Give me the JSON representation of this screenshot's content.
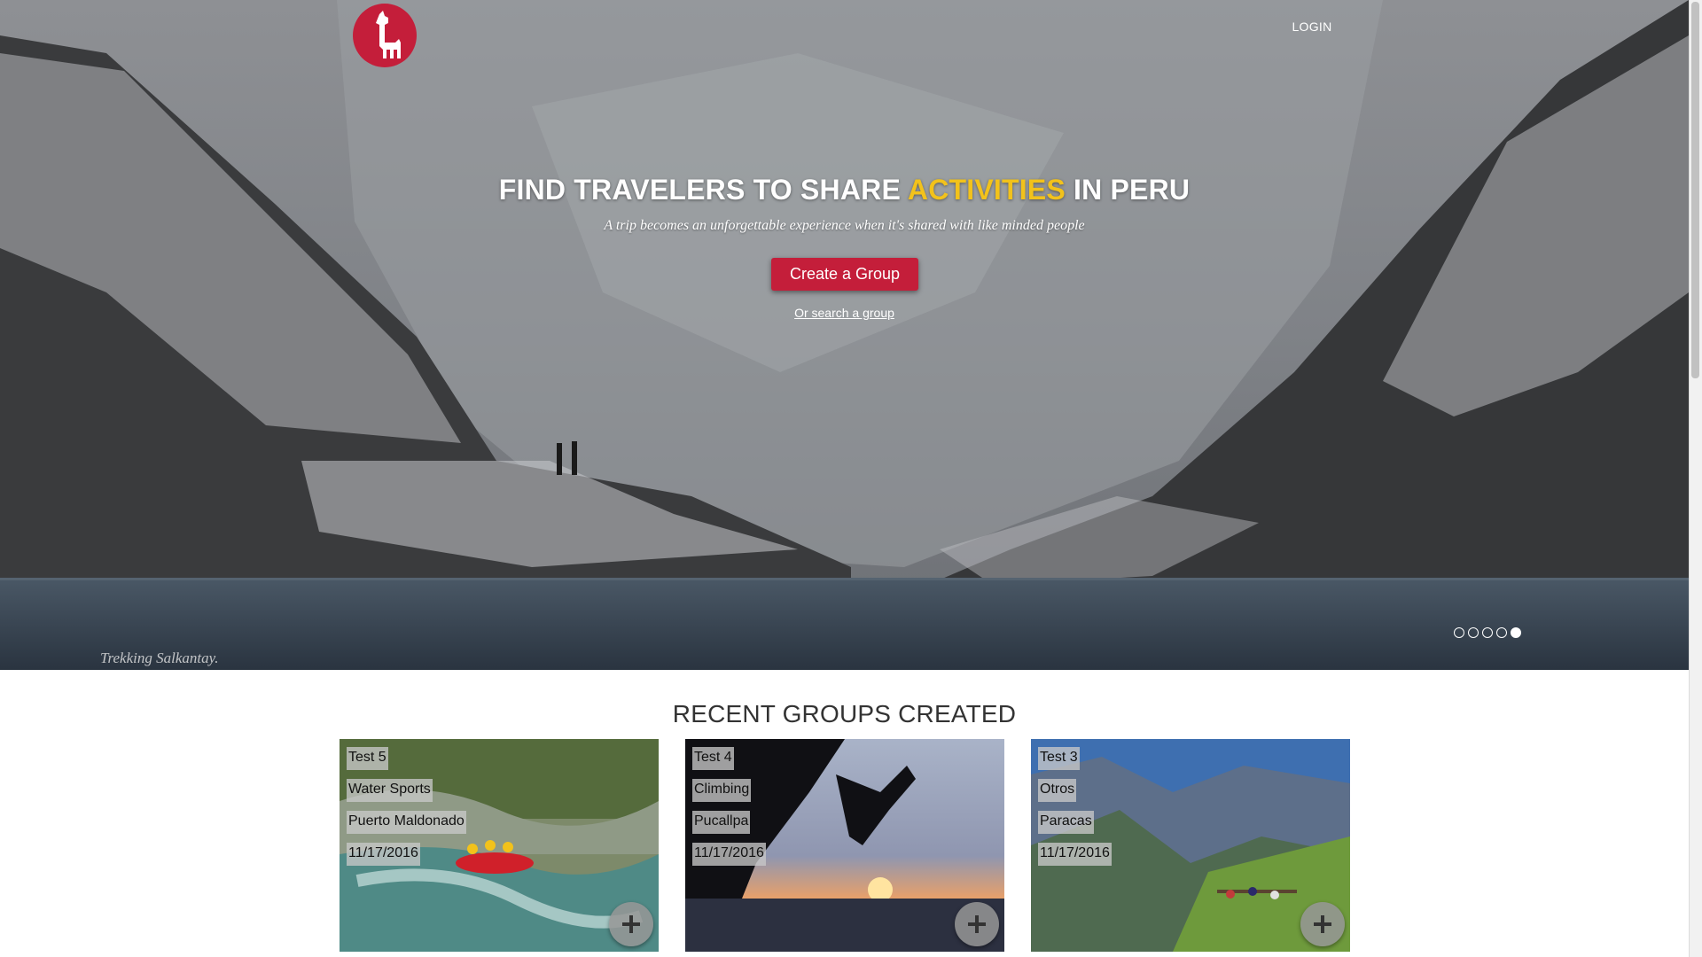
{
  "header": {
    "logo_icon": "llama-icon",
    "login_label": "LOGIN"
  },
  "hero": {
    "title_before": "FIND TRAVELERS TO SHARE ",
    "title_accent": "ACTIVITIES",
    "title_after": " IN PERU",
    "subtitle": "A trip becomes an unforgettable experience when it's shared with like minded people",
    "create_button_label": "Create a Group",
    "search_link_label": "Or search a group",
    "caption": "Trekking Salkantay.",
    "slide_count": 5,
    "active_slide": 5,
    "colors": {
      "accent": "#f2c21b",
      "brand": "#c41e3a"
    }
  },
  "recent": {
    "title": "RECENT GROUPS CREATED",
    "groups": [
      {
        "name": "Test 5",
        "category": "Water Sports",
        "location": "Puerto Maldonado",
        "date": "11/17/2016",
        "image": "rafting-river-photo",
        "action_icon": "plus-icon"
      },
      {
        "name": "Test 4",
        "category": "Climbing",
        "location": "Pucallpa",
        "date": "11/17/2016",
        "image": "climber-sunset-photo",
        "action_icon": "plus-icon"
      },
      {
        "name": "Test 3",
        "category": "Otros",
        "location": "Paracas",
        "date": "11/17/2016",
        "image": "canyon-viewpoint-photo",
        "action_icon": "plus-icon"
      }
    ]
  }
}
